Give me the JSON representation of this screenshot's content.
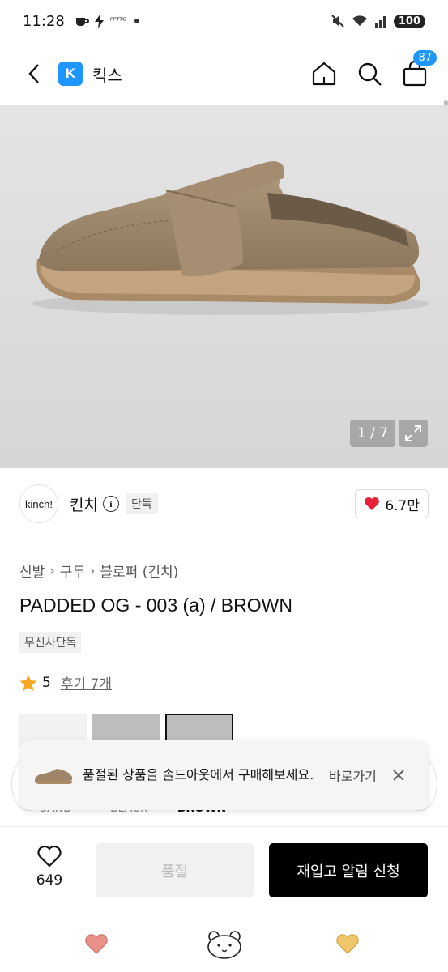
{
  "status_bar": {
    "time": "11:28",
    "battery": "100",
    "notif_text": "ᴾᴾᵀᵀᴳ"
  },
  "header": {
    "store_logo_letter": "K",
    "store_name": "킥스",
    "cart_count": "87"
  },
  "gallery": {
    "pager": "1 / 7"
  },
  "brand": {
    "logo_text": "kinch!",
    "name": "킨치",
    "info_glyph": "i",
    "tag": "단독",
    "likes": "6.7만"
  },
  "breadcrumb": [
    "신발",
    "구두",
    "블로퍼 (킨치)"
  ],
  "product": {
    "title": "PADDED OG - 003 (a) / BROWN",
    "tag": "무신사단독",
    "rating": "5",
    "reviews": "후기 7개"
  },
  "colors": {
    "options": [
      "SAND",
      "BLACK",
      "BROWN"
    ],
    "selected": "BROWN"
  },
  "toast": {
    "message": "품절된 상품을 솔드아웃에서 구매해보세요.",
    "link": "바로가기"
  },
  "bottom": {
    "wish_count": "649",
    "soldout_label": "품절",
    "restock_label": "재입고 알림 신청"
  },
  "icons": {
    "back": "chevron-left-icon",
    "home": "home-icon",
    "search": "search-icon",
    "cart": "cart-icon",
    "expand": "expand-icon",
    "heart": "heart-icon",
    "star": "star-icon",
    "close": "close-icon"
  },
  "accent_colors": {
    "brand_blue": "#1e96ff",
    "heart_red": "#e8223b",
    "star_orange": "#f5a623"
  }
}
